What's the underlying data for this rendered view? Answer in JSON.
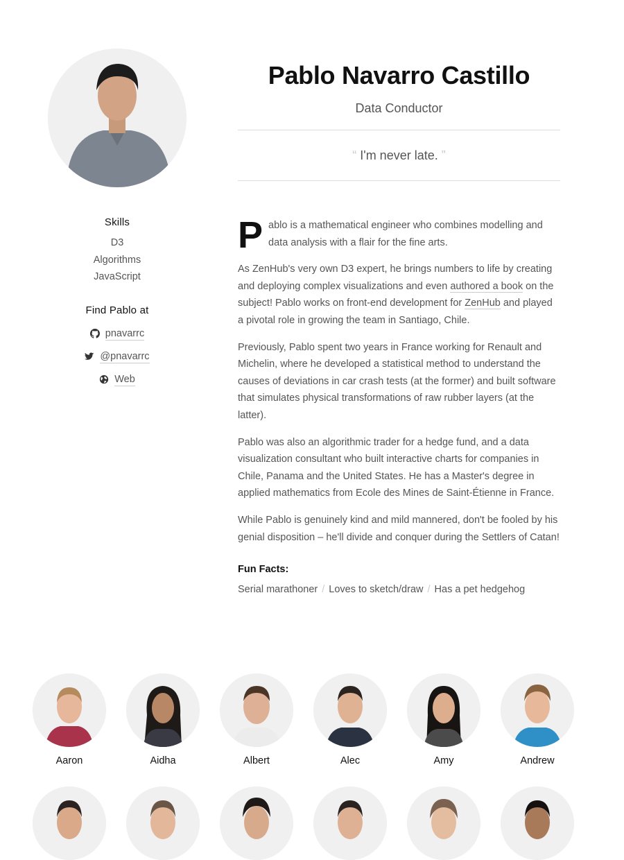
{
  "profile": {
    "name": "Pablo Navarro Castillo",
    "title": "Data Conductor",
    "quote": "I'm never late.",
    "quote_open": "“",
    "quote_close": "”"
  },
  "sidebar": {
    "skills_heading": "Skills",
    "skills": [
      "D3",
      "Algorithms",
      "JavaScript"
    ],
    "find_heading": "Find Pablo at",
    "links": [
      {
        "icon": "github-icon",
        "label": "pnavarrc"
      },
      {
        "icon": "twitter-icon",
        "label": "@pnavarrc"
      },
      {
        "icon": "globe-icon",
        "label": "Web"
      }
    ]
  },
  "bio": {
    "dropcap": "P",
    "p1_rest": "ablo is a mathematical engineer who combines modelling and data analysis with a flair for the fine arts.",
    "p2_a": "As ZenHub's very own D3 expert, he brings numbers to life by creating and deploying complex visualizations and even ",
    "p2_link1": "authored a book",
    "p2_b": " on the subject! Pablo works on front-end development for ",
    "p2_link2": "ZenHub",
    "p2_c": " and played a pivotal role in growing the team in Santiago, Chile.",
    "p3": "Previously, Pablo spent two years in France working for Renault and Michelin, where he developed a statistical method to understand the causes of deviations in car crash tests (at the former) and built software that simulates physical transformations of raw rubber layers (at the latter).",
    "p4": "Pablo was also an algorithmic trader for a hedge fund, and a data visualization consultant who built interactive charts for companies in Chile, Panama and the United States. He has a Master's degree in applied mathematics from Ecole des Mines de Saint-Étienne in France.",
    "p5": "While Pablo is genuinely kind and mild mannered, don't be fooled by his genial disposition – he'll divide and conquer during the Settlers of Catan!"
  },
  "fun_facts": {
    "heading": "Fun Facts:",
    "items": [
      "Serial marathoner",
      "Loves to sketch/draw",
      "Has a pet hedgehog"
    ],
    "separator": "/"
  },
  "team": {
    "members": [
      "Aaron",
      "Aidha",
      "Albert",
      "Alec",
      "Amy",
      "Andrew"
    ]
  },
  "colors": {
    "avatar_bg": "#f0f0f0",
    "text": "#555555",
    "heading": "#111111",
    "rule": "#dcdcdc"
  }
}
